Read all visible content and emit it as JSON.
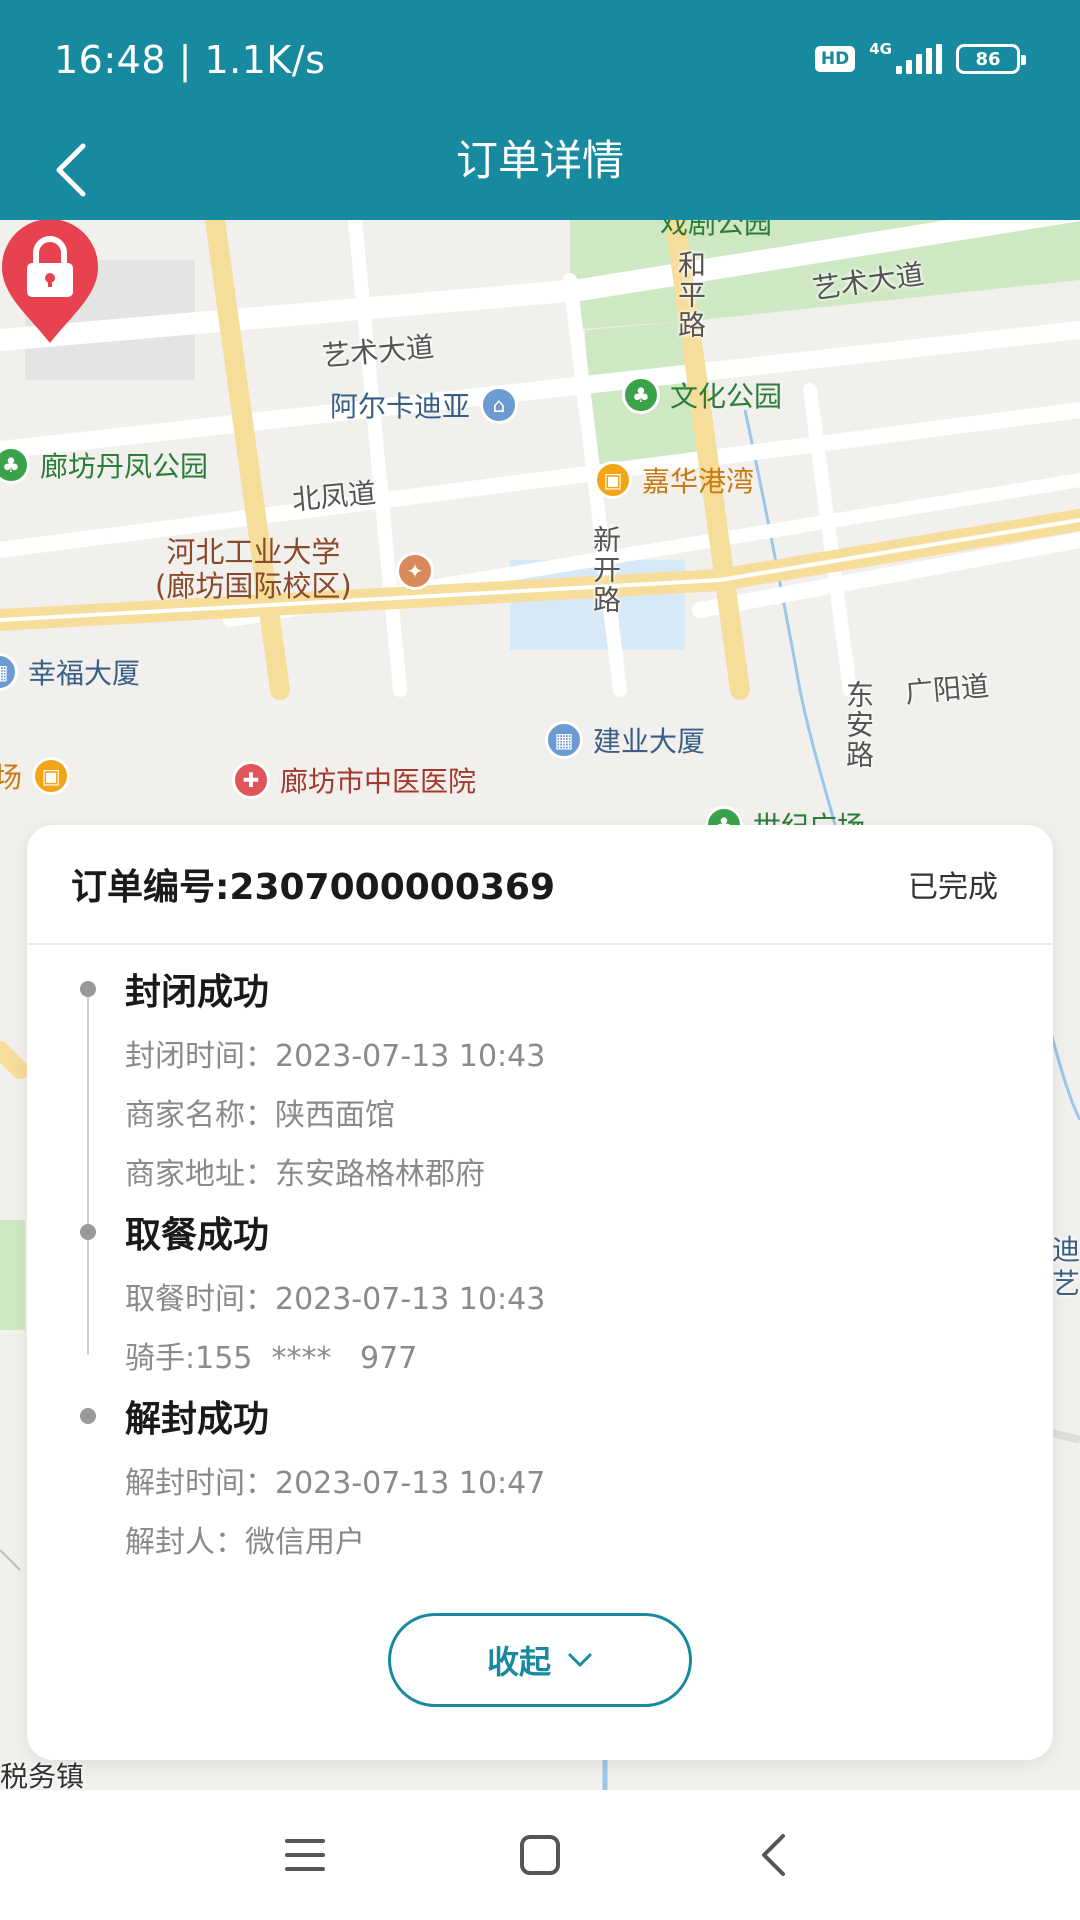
{
  "status_bar": {
    "time": "16:48 | 1.1K/s",
    "hd": "HD",
    "network": "4G",
    "battery": "86"
  },
  "nav": {
    "title": "订单详情",
    "back_icon": "chevron-left-icon"
  },
  "map": {
    "roads": [
      "艺术大道",
      "艺术大道",
      "北凤道",
      "和平路",
      "新开路",
      "东安路",
      "广阳道"
    ],
    "pois": {
      "park_top": "戏剧公园",
      "arcadia": "阿尔卡迪亚",
      "culture_park": "文化公园",
      "danfeng_park": "廊坊丹凤公园",
      "jiahua": "嘉华港湾",
      "hebei_univ_1": "河北工业大学",
      "hebei_univ_2": "(廊坊国际校区)",
      "xingfu": "幸福大厦",
      "jianye": "建业大厦",
      "hospital": "廊坊市中医医院",
      "century": "世纪广场",
      "left_partial": "场",
      "bottom_left": "税务镇",
      "right_partial_1": "迪",
      "right_partial_2": "艺设"
    },
    "marker_icon": "lock-icon"
  },
  "order": {
    "number_label": "订单编号:2307000000369",
    "status": "已完成",
    "steps": [
      {
        "title": "封闭成功",
        "lines": [
          "封闭时间：2023-07-13 10:43",
          "商家名称：陕西面馆",
          "商家地址：东安路格林郡府"
        ]
      },
      {
        "title": "取餐成功",
        "lines": [
          "取餐时间：2023-07-13 10:43",
          "骑手:155  ****   977"
        ]
      },
      {
        "title": "解封成功",
        "lines": [
          "解封时间：2023-07-13 10:47",
          "解封人：微信用户"
        ]
      }
    ],
    "collapse_label": "收起"
  },
  "colors": {
    "primary": "#188aa0",
    "marker": "#e8414f"
  }
}
